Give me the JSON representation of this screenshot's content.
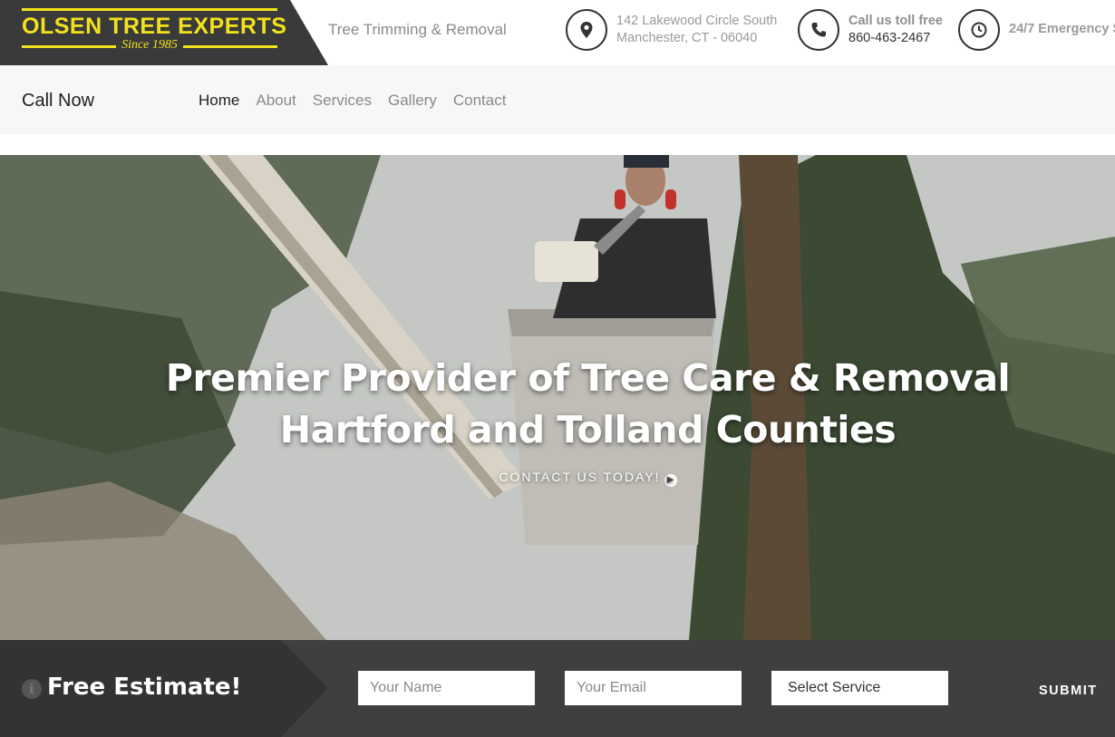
{
  "header": {
    "logo_name": "OLSEN TREE EXPERTS",
    "logo_since": "Since 1985",
    "tagline": "Tree Trimming & Removal",
    "address": {
      "line1": "142 Lakewood Circle South",
      "line2": "Manchester, CT - 06040",
      "icon": "map-pin-icon"
    },
    "phone": {
      "line1": "Call us toll free",
      "line2": "860-463-2467",
      "icon": "phone-icon"
    },
    "hours": {
      "line1": "24/7 Emergency S",
      "icon": "clock-icon"
    }
  },
  "nav": {
    "call_now": "Call Now",
    "items": [
      {
        "label": "Home",
        "active": true
      },
      {
        "label": "About"
      },
      {
        "label": "Services"
      },
      {
        "label": "Gallery"
      },
      {
        "label": "Contact"
      }
    ]
  },
  "hero": {
    "title_line1": "Premier Provider of Tree Care & Removal",
    "title_line2": "Hartford and Tolland Counties",
    "cta": "CONTACT US TODAY!"
  },
  "estimate": {
    "title": "Free Estimate!",
    "name_placeholder": "Your Name",
    "email_placeholder": "Your Email",
    "service_selected": "Select Service",
    "submit_label": "SUBMIT"
  },
  "colors": {
    "brand_yellow": "#f2e21b",
    "dark": "#3a3a3a",
    "nav_bg": "#f6f7f9",
    "estimate_bg": "#3f3f3f"
  }
}
